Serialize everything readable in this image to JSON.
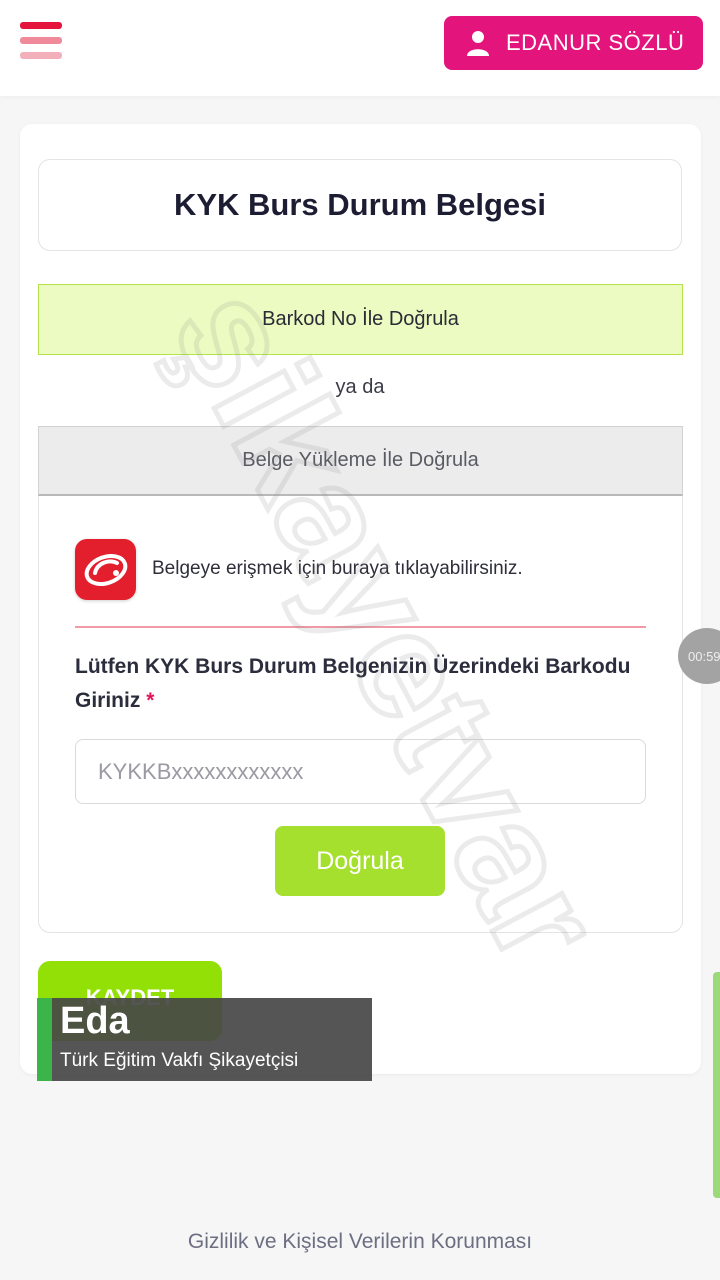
{
  "header": {
    "user_name": "EDANUR SÖZLÜ",
    "user_button_color": "#e3157d",
    "menu_icon": "hamburger-menu-icon"
  },
  "card": {
    "title": "KYK Burs Durum Belgesi",
    "tab_barcode": "Barkod No İle Doğrula",
    "or_text": "ya da",
    "tab_upload": "Belge Yükleme İle Doğrula",
    "access_text": "Belgeye erişmek için buraya tıklayabilirsiniz.",
    "field_label": "Lütfen KYK Burs Durum Belgenizin Üzerindeki Barkodu Giriniz",
    "required_mark": "*",
    "barcode_placeholder": "KYKKBxxxxxxxxxxxx",
    "verify_label": "Doğrula",
    "save_label": "KAYDET"
  },
  "overlay": {
    "name": "Eda",
    "subtitle": "Türk Eğitim Vakfı Şikayetçisi"
  },
  "timer": "00:59",
  "watermark": "şikayetvar",
  "footer": {
    "privacy_link": "Gizlilik ve Kişisel Verilerin Korunması"
  },
  "colors": {
    "accent_green": "#a6e02e",
    "barcode_tab_bg": "#ecfbc1",
    "edevlet_red": "#e31e2d"
  }
}
